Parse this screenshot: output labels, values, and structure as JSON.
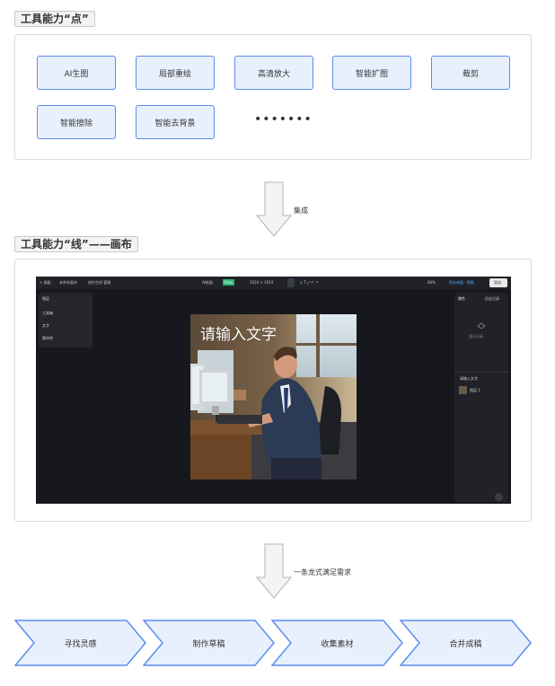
{
  "points_section": {
    "title": "工具能力“点”",
    "tools": [
      {
        "label": "AI生图"
      },
      {
        "label": "局部重绘"
      },
      {
        "label": "高清放大"
      },
      {
        "label": "智能扩图"
      },
      {
        "label": "裁剪"
      },
      {
        "label": "智能擦除"
      },
      {
        "label": "智能去背景"
      }
    ],
    "more": "•••••••"
  },
  "arrow1": {
    "label": "集成"
  },
  "line_section": {
    "title": "工具能力“线”——画布",
    "canvas_app": {
      "topbar": {
        "back": "< 画板",
        "file": "未命名画布",
        "tabs": "创作空间 管理",
        "mode": "AI绘画",
        "mode_badge": "Beta",
        "size": "1024 × 1024",
        "zoom": "66%",
        "credits": "积分充值 · 帮助",
        "export": "导出"
      },
      "layers": [
        {
          "label": "图层"
        },
        {
          "label": "工具箱"
        },
        {
          "label": "文字"
        },
        {
          "label": "素材库"
        }
      ],
      "right_panel": {
        "header": "属性",
        "tab": "历史记录",
        "empty_hint": "暂无记录",
        "text_item": "请输入文字",
        "image_item": "图层 1"
      },
      "photo_text": "请输入文字"
    }
  },
  "arrow2": {
    "label": "一条龙式满足需求"
  },
  "steps": [
    {
      "label": "寻找灵感"
    },
    {
      "label": "制作草稿"
    },
    {
      "label": "收集素材"
    },
    {
      "label": "合并成稿"
    }
  ],
  "colors": {
    "tool_border": "#5b8def",
    "tool_fill": "#e8f0fd",
    "canvas_bg": "#16181d"
  }
}
